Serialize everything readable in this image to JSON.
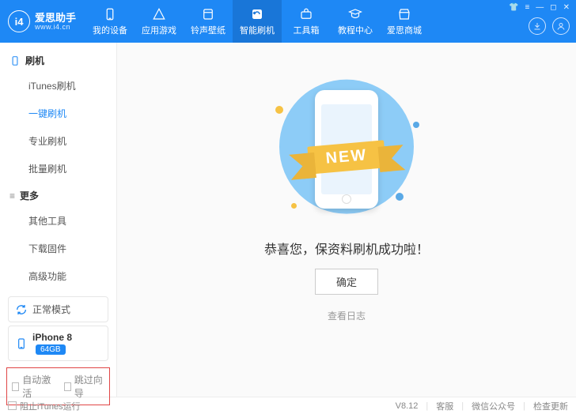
{
  "app": {
    "title": "爱思助手",
    "subtitle": "www.i4.cn",
    "logo_text": "i4"
  },
  "tabs": [
    {
      "label": "我的设备"
    },
    {
      "label": "应用游戏"
    },
    {
      "label": "铃声壁纸"
    },
    {
      "label": "智能刷机"
    },
    {
      "label": "工具箱"
    },
    {
      "label": "教程中心"
    },
    {
      "label": "爱思商城"
    }
  ],
  "sidebar": {
    "sections": [
      {
        "title": "刷机",
        "items": [
          "iTunes刷机",
          "一键刷机",
          "专业刷机",
          "批量刷机"
        ]
      },
      {
        "title": "更多",
        "items": [
          "其他工具",
          "下载固件",
          "高级功能"
        ]
      }
    ],
    "mode": {
      "label": "正常模式"
    },
    "device": {
      "name": "iPhone 8",
      "storage": "64GB"
    },
    "checks": {
      "auto_activate": "自动激活",
      "skip_guide": "跳过向导"
    }
  },
  "main": {
    "ribbon": "NEW",
    "success": "恭喜您，保资料刷机成功啦！",
    "ok": "确定",
    "view_log": "查看日志"
  },
  "footer": {
    "prevent_itunes": "阻止iTunes运行",
    "version": "V8.12",
    "support": "客服",
    "wechat": "微信公众号",
    "check_update": "检查更新"
  }
}
